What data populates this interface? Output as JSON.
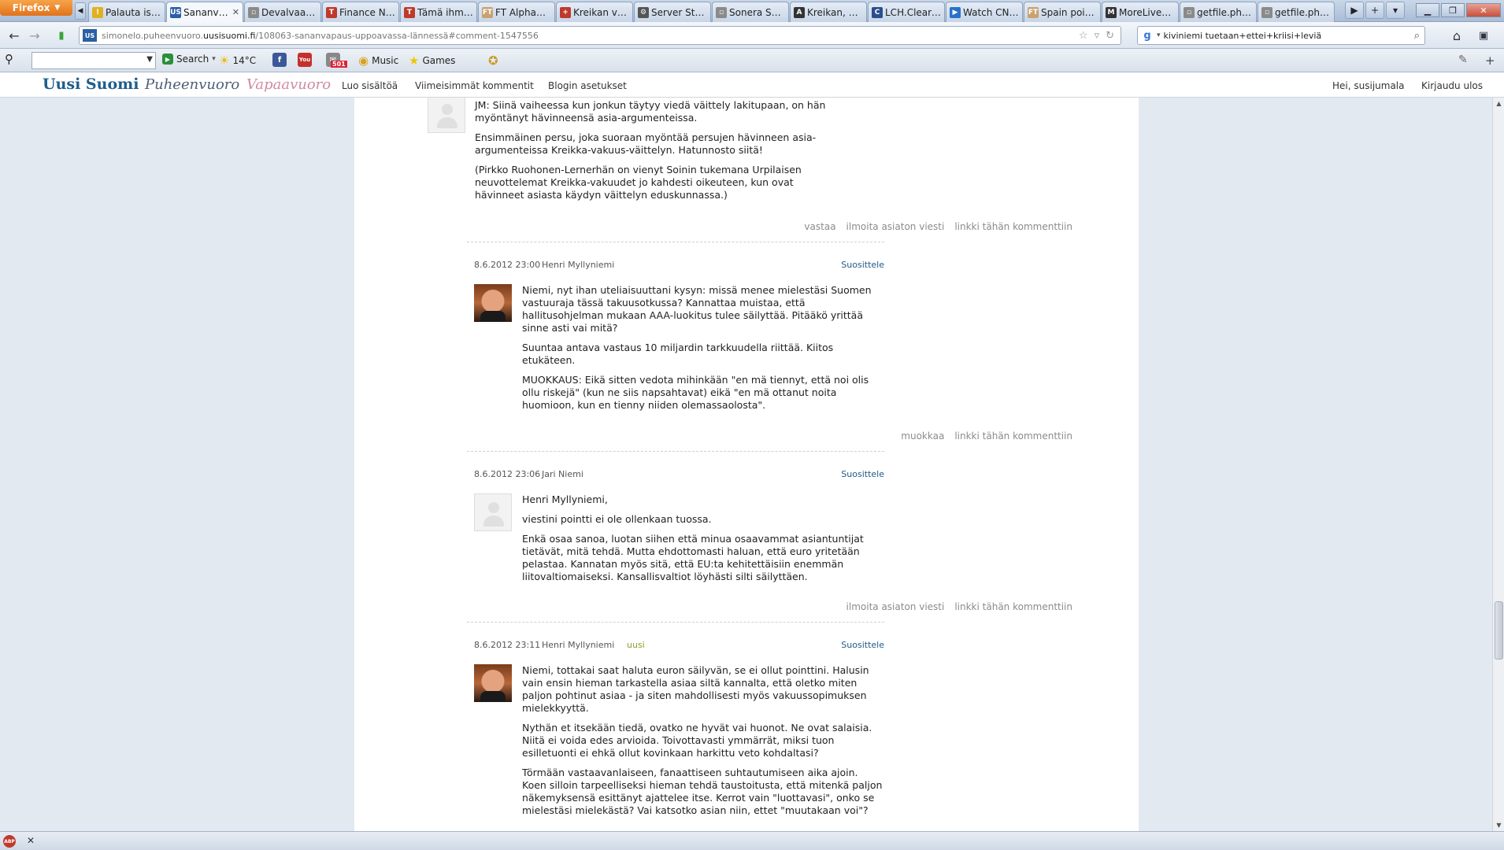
{
  "browser": {
    "firefox_label": "Firefox",
    "tabs": [
      {
        "label": "Palauta istu…",
        "icon": "warning-icon",
        "color": "#e0b020"
      },
      {
        "label": "Sananva…",
        "icon": "us-icon",
        "color": "#2b5fa4",
        "active": true
      },
      {
        "label": "Devalvaatio…",
        "icon": "page-icon",
        "color": "#8a8a8a"
      },
      {
        "label": "Finance Ne…",
        "icon": "t-icon",
        "color": "#c0392b"
      },
      {
        "label": "Tämä ihmel…",
        "icon": "te-icon",
        "color": "#c0392b"
      },
      {
        "label": "FT Alphavill…",
        "icon": "ft-icon",
        "color": "#c9a26e"
      },
      {
        "label": "Kreikan virk…",
        "icon": "plus-icon",
        "color": "#c0392b"
      },
      {
        "label": "Server Statu…",
        "icon": "gear-icon",
        "color": "#555555"
      },
      {
        "label": "Sonera Sähk…",
        "icon": "page-icon",
        "color": "#8a8a8a"
      },
      {
        "label": "Kreikan, Etel…",
        "icon": "a-icon",
        "color": "#333333"
      },
      {
        "label": "LCH.Clearn…",
        "icon": "c-icon",
        "color": "#2b4f8c"
      },
      {
        "label": "Watch CNB…",
        "icon": "play-icon",
        "color": "#2a72c9"
      },
      {
        "label": "Spain poise…",
        "icon": "ft-icon",
        "color": "#c9a26e"
      },
      {
        "label": "MoreLiver's …",
        "icon": "m-icon",
        "color": "#333333"
      },
      {
        "label": "getfile.php (…",
        "icon": "page-icon",
        "color": "#8a8a8a"
      },
      {
        "label": "getfile.php (…",
        "icon": "page-icon",
        "color": "#8a8a8a"
      }
    ],
    "url_prefix": "simonelo.puheenvuoro.",
    "url_domain": "uusisuomi.fi",
    "url_path": "/108063-sananvapaus-uppoavassa-lännessä#comment-1547556",
    "search_query": "kiviniemi tuetaan+ettei+kriisi+leviä"
  },
  "toolbar": {
    "search_label": "Search",
    "weather": "14°C",
    "badge": "501",
    "music_label": "Music",
    "games_label": "Games"
  },
  "site": {
    "logo": "Uusi Suomi",
    "puheenvuoro": "Puheenvuoro",
    "vapaavuoro": "Vapaavuoro",
    "nav": {
      "create": "Luo sisältöä",
      "latest_comments": "Viimeisimmät kommentit",
      "blog_settings": "Blogin asetukset",
      "greeting": "Hei, susijumala",
      "logout": "Kirjaudu ulos"
    }
  },
  "comments": [
    {
      "paragraphs": [
        "JM: Siinä vaiheessa kun jonkun täytyy viedä väittely lakitupaan, on hän myöntänyt hävinneensä asia-argumenteissa.",
        "Ensimmäinen persu, joka suoraan myöntää persujen hävinneen asia-argumenteissa Kreikka-vakuus-väittelyn. Hatunnosto siitä!",
        "(Pirkko Ruohonen-Lernerhän on vienyt Soinin tukemana Urpilaisen neuvottelemat Kreikka-vakuudet jo kahdesti oikeuteen, kun ovat hävinneet asiasta käydyn väittelyn eduskunnassa.)"
      ],
      "actions": [
        "vastaa",
        "ilmoita asiaton viesti",
        "linkki tähän kommenttiin"
      ]
    },
    {
      "date": "8.6.2012 23:00",
      "author": "Henri Myllyniemi",
      "recommend": "Suosittele",
      "paragraphs": [
        "Niemi, nyt ihan uteliaisuuttani kysyn: missä menee mielestäsi Suomen vastuuraja tässä takuusotkussa? Kannattaa muistaa, että hallitusohjelman mukaan AAA-luokitus tulee säilyttää. Pitääkö yrittää sinne asti vai mitä?",
        "Suuntaa antava vastaus 10 miljardin tarkkuudella riittää. Kiitos etukäteen.",
        "MUOKKAUS: Eikä sitten vedota mihinkään \"en mä tiennyt, että noi olis ollu riskejä\" (kun ne siis napsahtavat) eikä \"en mä ottanut noita huomioon, kun en tienny niiden olemassaolosta\"."
      ],
      "actions": [
        "muokkaa",
        "linkki tähän kommenttiin"
      ]
    },
    {
      "date": "8.6.2012 23:06",
      "author": "Jari Niemi",
      "recommend": "Suosittele",
      "paragraphs": [
        "Henri Myllyniemi,",
        "viestini pointti ei ole ollenkaan tuossa.",
        "Enkä osaa sanoa, luotan siihen että minua osaavammat asiantuntijat tietävät, mitä tehdä. Mutta ehdottomasti haluan, että euro yritetään pelastaa. Kannatan myös sitä, että EU:ta kehitettäisiin enemmän liitovaltiomaiseksi. Kansallisvaltiot löyhästi silti säilyttäen."
      ],
      "actions": [
        "ilmoita asiaton viesti",
        "linkki tähän kommenttiin"
      ]
    },
    {
      "date": "8.6.2012 23:11",
      "author": "Henri Myllyniemi",
      "new_label": "uusi",
      "recommend": "Suosittele",
      "paragraphs": [
        "Niemi, tottakai saat haluta euron säilyvän, se ei ollut pointtini. Halusin vain ensin hieman tarkastella asiaa siltä kannalta, että oletko miten paljon pohtinut asiaa - ja siten mahdollisesti myös vakuussopimuksen mielekkyyttä.",
        "Nythän et itsekään tiedä, ovatko ne hyvät vai huonot. Ne ovat salaisia. Niitä ei voida edes arvioida. Toivottavasti ymmärrät, miksi tuon esilletuonti ei ehkä ollut kovinkaan harkittu veto kohdaltasi?",
        "Törmään vastaavanlaiseen, fanaattiseen suhtautumiseen aika ajoin. Koen silloin tarpeelliseksi hieman tehdä taustoitusta, että mitenkä paljon näkemyksensä esittänyt ajattelee itse. Kerrot vain \"luottavasi\", onko se mielestäsi mielekästä? Vai katsotko asian niin, ettet \"muutakaan voi\"?"
      ]
    }
  ]
}
